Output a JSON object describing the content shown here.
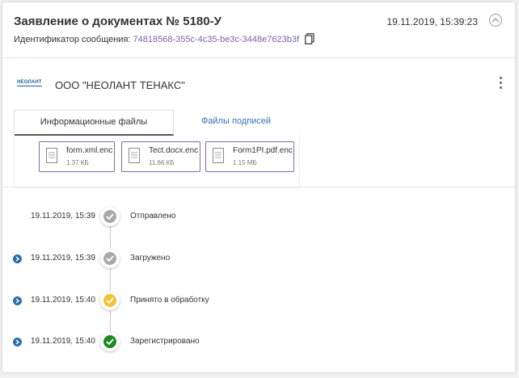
{
  "header": {
    "title": "Заявление о документах № 5180-У",
    "date": "19.11.2019, 15:39:23",
    "message_id_label": "Идентификатор сообщения:",
    "message_id_value": "74818568-355c-4c35-be3c-3448e7623b3f"
  },
  "organization": {
    "logo_text": "НЕОЛАНТ",
    "name": "ООО \"НЕОЛАНТ ТЕНАКС\""
  },
  "tabs": [
    {
      "label": "Информационные файлы",
      "active": true
    },
    {
      "label": "Файлы подписей",
      "active": false
    }
  ],
  "files": [
    {
      "name": "form.xml.enc",
      "size": "1.37 КБ"
    },
    {
      "name": "Tect.docx.enc",
      "size": "11.66 КБ"
    },
    {
      "name": "Form1PI.pdf.enc",
      "size": "1.15 МБ"
    }
  ],
  "timeline": [
    {
      "time": "19.11.2019, 15:39",
      "status": "Отправлено",
      "state": "done-gray",
      "has_arrow": false
    },
    {
      "time": "19.11.2019, 15:39",
      "status": "Загружено",
      "state": "done-gray",
      "has_arrow": true
    },
    {
      "time": "19.11.2019, 15:40",
      "status": "Принято в обработку",
      "state": "done-yellow",
      "has_arrow": true
    },
    {
      "time": "19.11.2019, 15:40",
      "status": "Зарегистрировано",
      "state": "done-green",
      "has_arrow": true
    }
  ],
  "colors": {
    "accent_link": "#7b61a6",
    "tab_link": "#3b6fb6",
    "status_gray": "#a8a8a8",
    "status_yellow": "#f2c230",
    "status_green": "#1c8a25",
    "arrow_blue": "#2f6ea6"
  },
  "icons": {
    "collapse": "chevron-up-icon",
    "copy": "copy-icon",
    "menu": "kebab-menu-icon",
    "file": "file-icon",
    "status": "check-icon",
    "expand": "chevron-right-icon"
  }
}
